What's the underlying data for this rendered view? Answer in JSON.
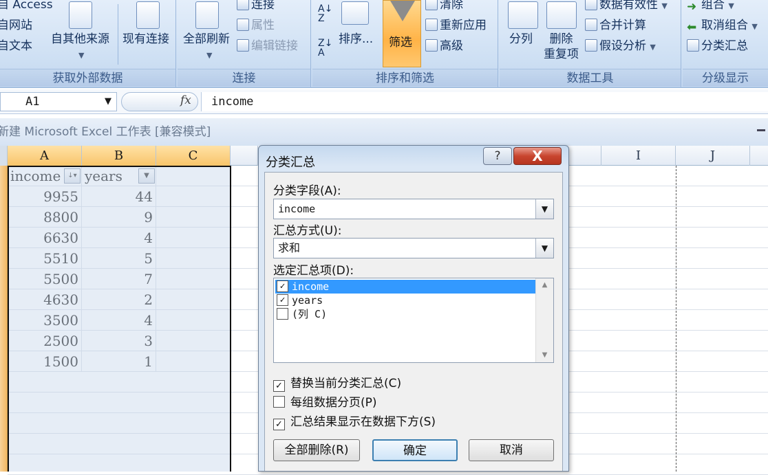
{
  "ribbon": {
    "external_data": {
      "items": [
        "自 Access",
        "自网站",
        "自文本"
      ],
      "other_sources": "自其他来源",
      "existing_connections": "现有连接",
      "label": "获取外部数据"
    },
    "connections": {
      "refresh_all": "全部刷新",
      "connections": "连接",
      "properties": "属性",
      "edit_links": "编辑链接",
      "label": "连接"
    },
    "sort_filter": {
      "sort": "排序...",
      "filter": "筛选",
      "clear": "清除",
      "reapply": "重新应用",
      "advanced": "高级",
      "label": "排序和筛选"
    },
    "data_tools": {
      "text_to_columns": "分列",
      "remove_dup_1": "删除",
      "remove_dup_2": "重复项",
      "validation": "数据有效性",
      "consolidate": "合并计算",
      "what_if": "假设分析",
      "label": "数据工具"
    },
    "outline": {
      "group": "组合",
      "ungroup": "取消组合",
      "subtotal": "分类汇总",
      "label": "分级显示"
    }
  },
  "formula_bar": {
    "name_box": "A1",
    "fx": "fx",
    "formula": "income"
  },
  "workbook_title": "新建 Microsoft Excel 工作表  [兼容模式]",
  "columns": {
    "A": "A",
    "B": "B",
    "C": "C",
    "I": "I",
    "J": "J"
  },
  "sheet": {
    "headers": [
      "income",
      "years"
    ],
    "rows": [
      [
        "9955",
        "44"
      ],
      [
        "8800",
        "9"
      ],
      [
        "6630",
        "4"
      ],
      [
        "5510",
        "5"
      ],
      [
        "5500",
        "7"
      ],
      [
        "4630",
        "2"
      ],
      [
        "3500",
        "4"
      ],
      [
        "2500",
        "3"
      ],
      [
        "1500",
        "1"
      ]
    ]
  },
  "dialog": {
    "title": "分类汇总",
    "help": "?",
    "close": "X",
    "field_label": "分类字段(A):",
    "field_value": "income",
    "func_label": "汇总方式(U):",
    "func_value": "求和",
    "items_label": "选定汇总项(D):",
    "items": [
      {
        "label": "income",
        "checked": true,
        "selected": true
      },
      {
        "label": "years",
        "checked": true,
        "selected": false
      },
      {
        "label": "(列 C)",
        "checked": false,
        "selected": false
      }
    ],
    "options": [
      {
        "label": "替换当前分类汇总(C)",
        "checked": true
      },
      {
        "label": "每组数据分页(P)",
        "checked": false
      },
      {
        "label": "汇总结果显示在数据下方(S)",
        "checked": true
      }
    ],
    "remove_all": "全部删除(R)",
    "ok": "确定",
    "cancel": "取消"
  }
}
